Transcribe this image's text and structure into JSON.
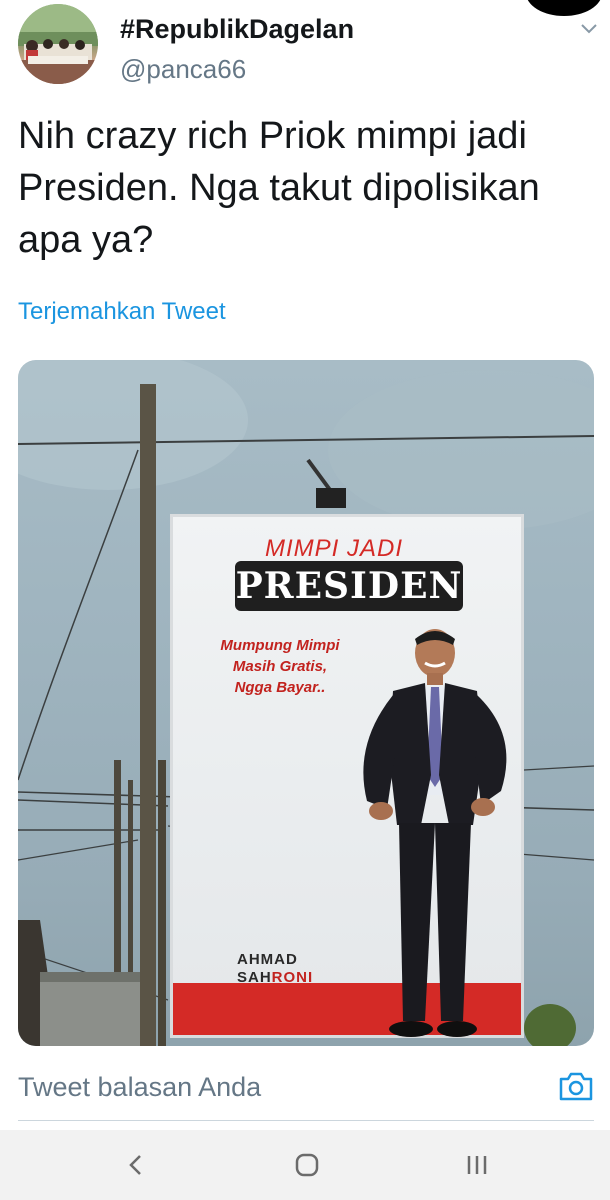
{
  "tweet": {
    "display_name": "#RepublikDagelan",
    "handle": "@panca66",
    "text": "Nih crazy rich Priok mimpi jadi Presiden. Nga takut dipolisikan apa ya?",
    "translate_label": "Terjemahkan Tweet"
  },
  "billboard": {
    "headline_top": "MIMPI JADI",
    "headline_main": "PRESIDEN",
    "tagline_line1": "Mumpung Mimpi",
    "tagline_line2": "Masih Gratis,",
    "tagline_line3": "Ngga Bayar..",
    "name_first": "AHMAD",
    "name_last_a": "SAH",
    "name_last_b": "RONI"
  },
  "reply": {
    "placeholder": "Tweet balasan Anda"
  },
  "icons": {
    "more": "chevron-down-icon",
    "camera": "camera-icon",
    "back": "back-icon",
    "home": "home-icon",
    "recent": "recent-apps-icon"
  },
  "colors": {
    "link": "#1b95e0",
    "secondary_text": "#657786",
    "billboard_red": "#d42a26"
  }
}
